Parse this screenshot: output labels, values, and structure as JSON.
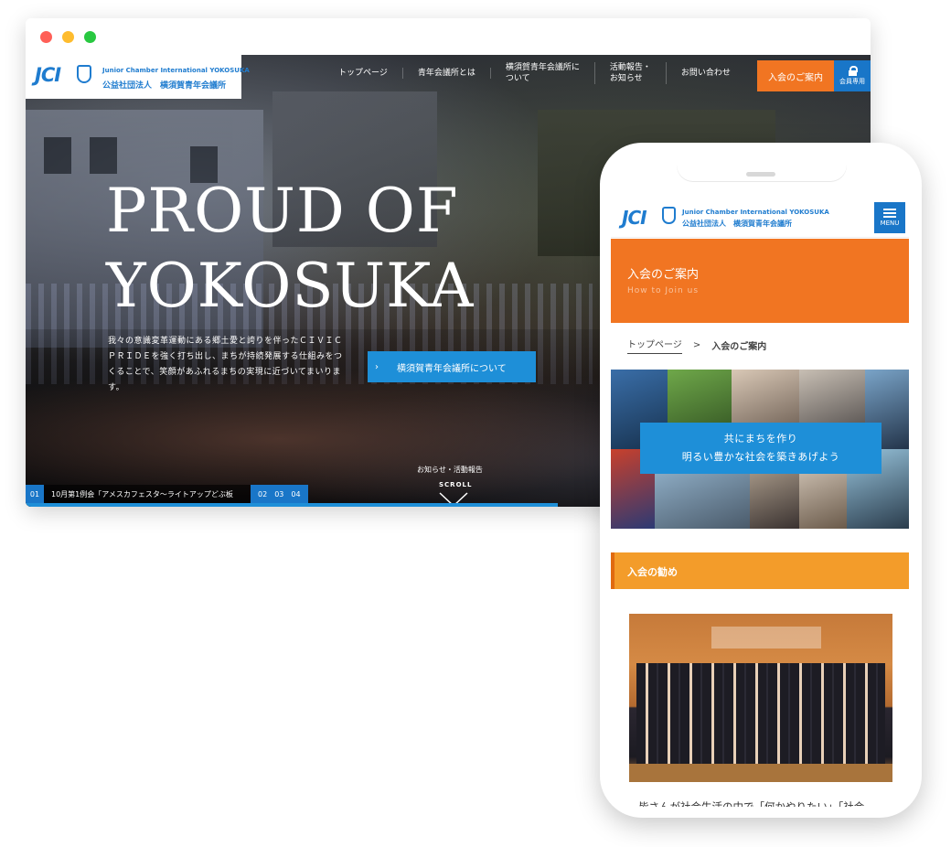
{
  "desktop": {
    "logo": {
      "mark": "JCI",
      "english": "Junior Chamber International YOKOSUKA",
      "japanese": "公益社団法人　横須賀青年会議所"
    },
    "nav": [
      {
        "label": "トップページ"
      },
      {
        "label": "青年会議所とは"
      },
      {
        "label": "横須賀青年会議所に\nついて"
      },
      {
        "label": "活動報告・\nお知らせ"
      },
      {
        "label": "お問い合わせ"
      }
    ],
    "join_button": "入会のご案内",
    "member_button": "会員専用",
    "hero": {
      "title_line1": "PROUD OF",
      "title_line2": "YOKOSUKA",
      "text": "我々の意識変革運動にある郷土愛と誇りを伴ったＣＩＶＩＣ ＰＲＩＤＥを強く打ち出し、まちが持続発展する仕組みをつくることで、笑顔があふれるまちの実現に近づいてまいります。",
      "about_button": "横須賀青年会議所について",
      "about_chevron": "›"
    },
    "news_label": "お知らせ・活動報告",
    "scroll_label": "SCROLL",
    "slider": {
      "current": "01",
      "text": "10月第1例会「アメスカフェスタ～ライトアップどぶ板",
      "pages": [
        "02",
        "03",
        "04"
      ],
      "progress": 0.63
    }
  },
  "mobile": {
    "logo": {
      "mark": "JCI",
      "english": "Junior Chamber International YOKOSUKA",
      "japanese": "公益社団法人　横須賀青年会議所"
    },
    "menu_label": "MENU",
    "banner": {
      "title": "入会のご案内",
      "subtitle": "How to Join us"
    },
    "breadcrumb": {
      "home": "トップページ",
      "separator": ">",
      "current": "入会のご案内"
    },
    "collage_caption": {
      "line1": "共にまちを作り",
      "line2": "明るい豊かな社会を築きあげよう"
    },
    "section_title": "入会の勧め",
    "body_text": "皆さんが社会生活の中で「何かやりたい」「社会"
  },
  "colors": {
    "brand_blue": "#1976c8",
    "accent_orange": "#f17522",
    "section_orange": "#f39c2a",
    "caption_blue": "#1e8fd8"
  }
}
